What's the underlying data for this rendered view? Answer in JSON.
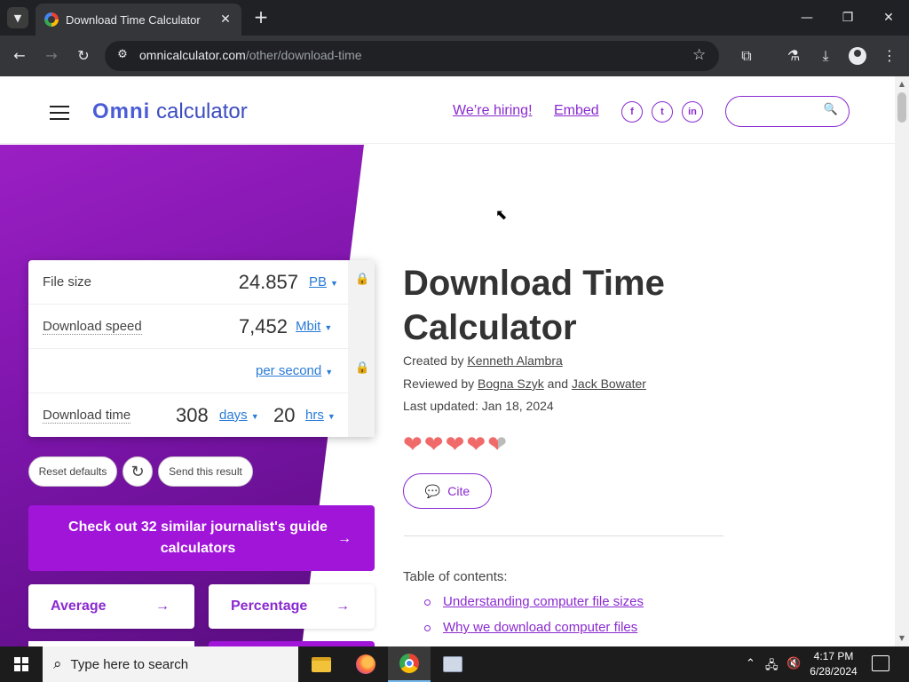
{
  "browser": {
    "tab_title": "Download Time Calculator",
    "url_host": "omnicalculator.com",
    "url_path": "/other/download-time"
  },
  "header": {
    "logo_omni": "Omni",
    "logo_calculator": "calculator",
    "hiring_link": "We’re hiring!",
    "embed_link": "Embed",
    "social": [
      "f",
      "t",
      "in"
    ]
  },
  "calculator": {
    "rows": [
      {
        "label": "File size",
        "value": "24.857",
        "unit": "PB"
      },
      {
        "label": "Download speed",
        "value": "7,452",
        "unit": "Mbit"
      },
      {
        "label": "",
        "value": "",
        "unit": "per second"
      },
      {
        "label": "Download time",
        "value": "308",
        "unit": "days",
        "value2": "20",
        "unit2": "hrs"
      }
    ],
    "reset_label": "Reset defaults",
    "send_label": "Send this result",
    "cta_label": "Check out 32 similar journalist's guide calculators",
    "related": [
      "Average",
      "Percentage"
    ]
  },
  "article": {
    "title": "Download Time Calculator",
    "created_prefix": "Created by",
    "created_by": "Kenneth Alambra",
    "reviewed_prefix": "Reviewed by",
    "reviewer_1": "Bogna Szyk",
    "and_word": "and",
    "reviewer_2": "Jack Bowater",
    "last_updated": "Last updated: Jan 18, 2024",
    "rating": 4.5,
    "cite_label": "Cite",
    "toc_title": "Table of contents:",
    "toc_items": [
      "Understanding computer file sizes",
      "Why we download computer files"
    ]
  },
  "taskbar": {
    "search_placeholder": "Type here to search",
    "time": "4:17 PM",
    "date": "6/28/2024"
  },
  "colors": {
    "accent": "#8a2ad0",
    "cta": "#a115d9",
    "hero_start": "#9b1fc4",
    "hero_end": "#5a0d80"
  }
}
